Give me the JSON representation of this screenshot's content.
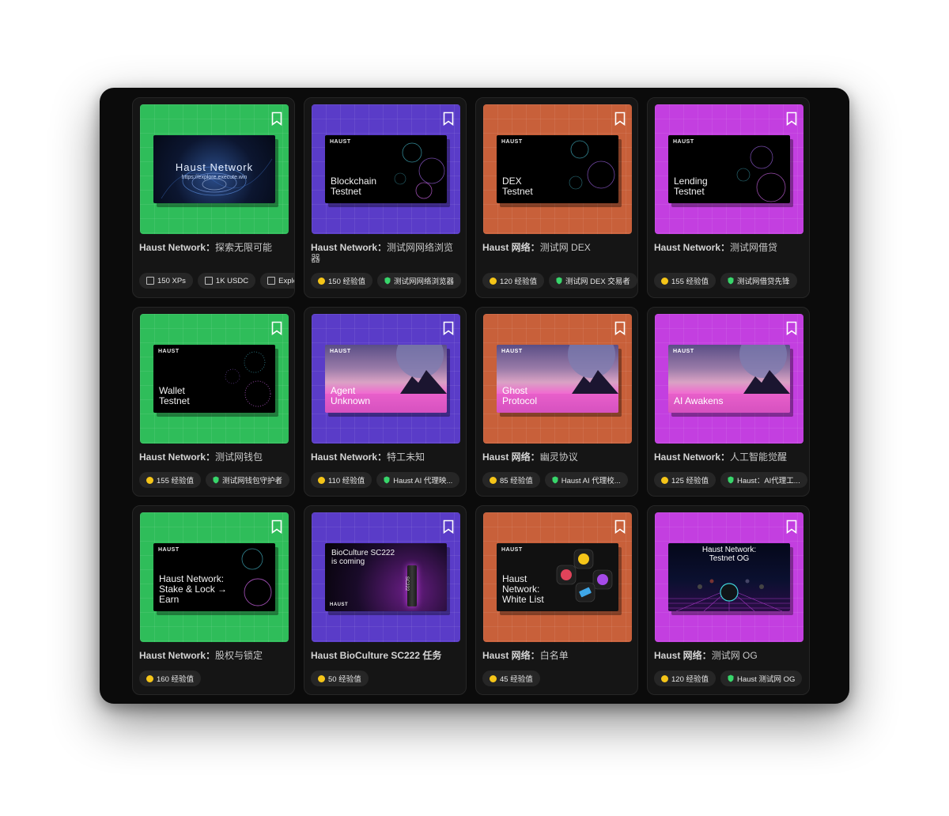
{
  "colors": {
    "green": "#2fbd5a",
    "purple": "#5a3cc8",
    "orange": "#c8603a",
    "magenta": "#c33fe0",
    "xp_coin": "#f5c518",
    "badge_shield": "#38d66b"
  },
  "cards": [
    {
      "title_bold": "Haust Network：",
      "title_rest": "探索无限可能",
      "art_title": "Haust Network",
      "art_sub": "https://explore.execute.win",
      "chips": [
        "150 XPs",
        "1K USDC",
        "Explo"
      ]
    },
    {
      "title_bold": "Haust Network：",
      "title_rest": "测试网网络浏览器",
      "brand": "HAUST",
      "art_title": "Blockchain\nTestnet",
      "chips": [
        "150 经验值",
        "测试网网络浏览器"
      ]
    },
    {
      "title_bold": "Haust 网络：",
      "title_rest": "测试网 DEX",
      "brand": "HAUST",
      "art_title": "DEX\nTestnet",
      "chips": [
        "120 经验值",
        "测试网 DEX 交易者"
      ]
    },
    {
      "title_bold": "Haust Network：",
      "title_rest": "测试网借贷",
      "brand": "HAUST",
      "art_title": "Lending\nTestnet",
      "chips": [
        "155 经验值",
        "测试网借贷先锋"
      ]
    },
    {
      "title_bold": "Haust Network：",
      "title_rest": "测试网钱包",
      "brand": "HAUST",
      "art_title": "Wallet\nTestnet",
      "chips": [
        "155 经验值",
        "测试网钱包守护者"
      ]
    },
    {
      "title_bold": "Haust Network：",
      "title_rest": "特工未知",
      "brand": "HAUST",
      "art_title": "Agent\nUnknown",
      "chips": [
        "110 经验值",
        "Haust AI 代理映..."
      ]
    },
    {
      "title_bold": "Haust 网络：",
      "title_rest": "幽灵协议",
      "brand": "HAUST",
      "art_title": "Ghost\nProtocol",
      "chips": [
        "85 经验值",
        "Haust AI 代理校..."
      ]
    },
    {
      "title_bold": "Haust Network：",
      "title_rest": "人工智能觉醒",
      "brand": "HAUST",
      "art_title": "AI Awakens",
      "chips": [
        "125 经验值",
        "Haust：AI代理工..."
      ]
    },
    {
      "title_bold": "Haust Network：",
      "title_rest": "股权与锁定",
      "brand": "HAUST",
      "art_title": "Haust Network:\nStake & Lock →\nEarn",
      "chips": [
        "160 经验值"
      ]
    },
    {
      "title_bold": "Haust BioCulture SC222 任务",
      "title_rest": "",
      "brand": "HAUST",
      "art_title": "BioCulture SC222\nis coming",
      "vial_label": "SC222",
      "chips": [
        "50 经验值"
      ]
    },
    {
      "title_bold": "Haust 网络：",
      "title_rest": "白名单",
      "brand": "HAUST",
      "art_title": "Haust\nNetwork:\nWhite List",
      "chips": [
        "45 经验值"
      ]
    },
    {
      "title_bold": "Haust 网络：",
      "title_rest": "测试网 OG",
      "art_title": "Haust Network:\nTestnet OG",
      "chips": [
        "120 经验值",
        "Haust 测试网 OG"
      ]
    }
  ]
}
